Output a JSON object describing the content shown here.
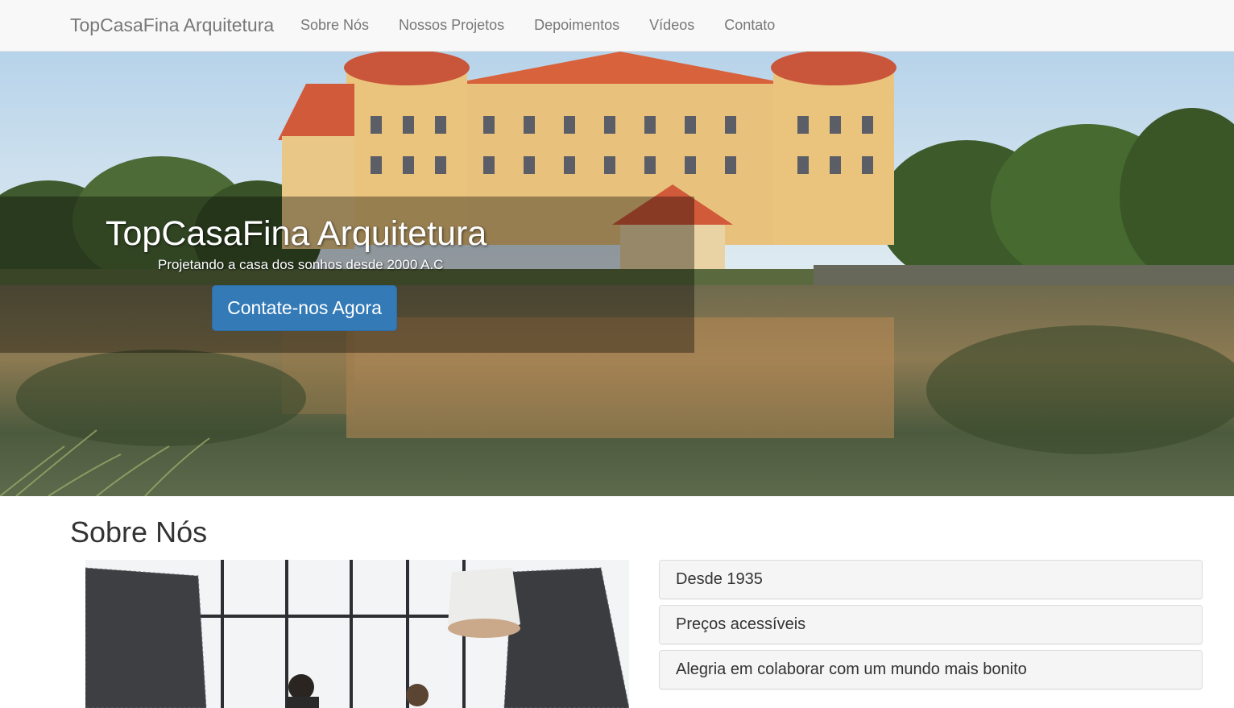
{
  "navbar": {
    "brand": "TopCasaFina Arquitetura",
    "links": [
      "Sobre Nós",
      "Nossos Projetos",
      "Depoimentos",
      "Vídeos",
      "Contato"
    ]
  },
  "hero": {
    "title": "TopCasaFina Arquitetura",
    "subtitle": "Projetando a casa dos sonhos desde 2000 A.C",
    "cta_label": "Contate-nos Agora"
  },
  "about": {
    "title": "Sobre Nós",
    "panels": [
      "Desde 1935",
      "Preços acessíveis",
      "Alegria em colaborar com um mundo mais bonito"
    ]
  },
  "colors": {
    "primary": "#337ab7",
    "navbar_bg": "#f8f8f8",
    "nav_text": "#777777"
  }
}
